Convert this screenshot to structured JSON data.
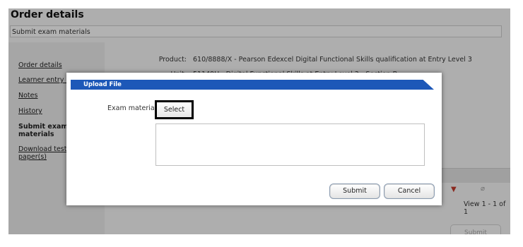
{
  "page": {
    "title": "Order details",
    "subtitle": "Submit exam materials"
  },
  "sidebar": {
    "items": [
      {
        "label": "Order details"
      },
      {
        "label": "Learner entry slips"
      },
      {
        "label": "Notes"
      },
      {
        "label": "History"
      },
      {
        "label": "Submit exam materials"
      },
      {
        "label": "Download test paper(s)"
      }
    ],
    "active": "Submit exam materials"
  },
  "details": {
    "product_label": "Product:",
    "product_value": "610/8888/X - Pearson Edexcel Digital Functional Skills qualification at Entry Level 3",
    "unit_label": "Unit:",
    "unit_value": "51149U - Digital Functional Skills at Entry Level 3 - Section B"
  },
  "grid": {
    "view_text": "View 1 - 1 of 1",
    "submit_label": "Submit"
  },
  "dialog": {
    "title": "Upload File",
    "field_label": "Exam material:",
    "select_label": "Select",
    "submit_label": "Submit",
    "cancel_label": "Cancel"
  }
}
